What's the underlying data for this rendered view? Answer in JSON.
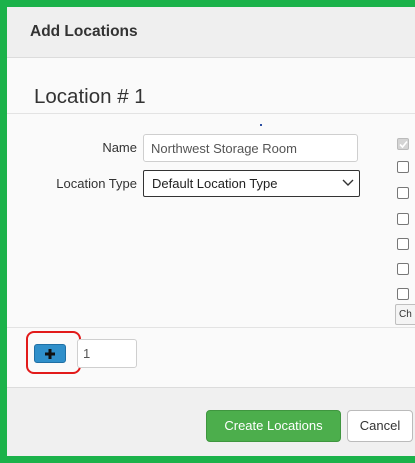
{
  "colors": {
    "frame_highlight": "#1bb24a",
    "callout_highlight": "#e21a1a",
    "primary_button": "#4cae4c",
    "add_button": "#2f8fca"
  },
  "dialog": {
    "title": "Add Locations"
  },
  "location": {
    "heading": "Location # 1",
    "name_label": "Name",
    "name_value": "Northwest Storage Room",
    "type_label": "Location Type",
    "type_value": "Default Location Type"
  },
  "right_panel": {
    "checkboxes": [
      {
        "checked": true,
        "disabled": true
      },
      {
        "checked": false
      },
      {
        "checked": false
      },
      {
        "checked": false
      },
      {
        "checked": false
      },
      {
        "checked": false
      },
      {
        "checked": false
      }
    ],
    "button_label": "Ch"
  },
  "add_row": {
    "add_icon": "plus-icon",
    "count_value": "1"
  },
  "footer": {
    "create_label": "Create Locations",
    "cancel_label": "Cancel"
  }
}
